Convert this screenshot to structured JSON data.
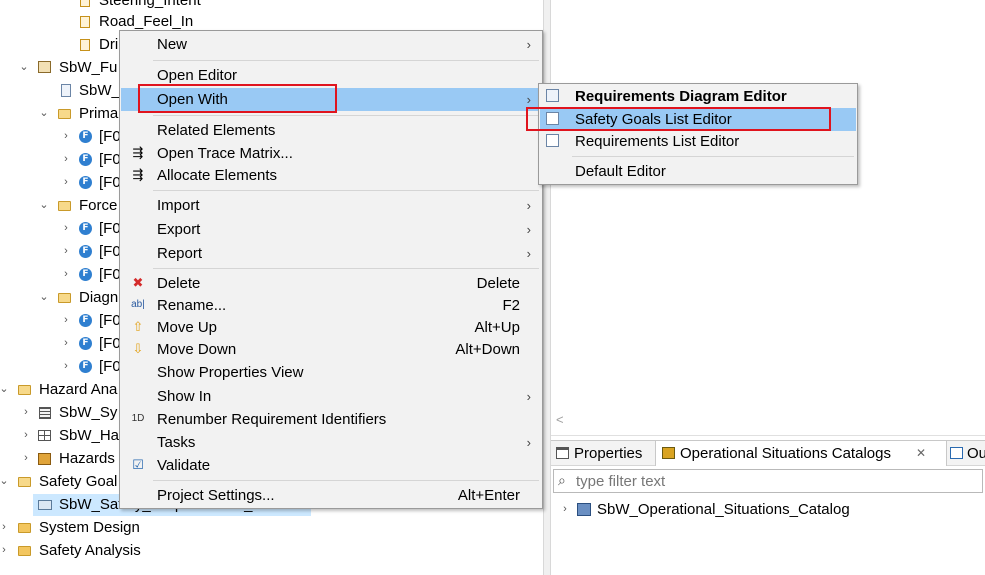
{
  "tree": {
    "items": [
      {
        "label": "Steering_Intent"
      },
      {
        "label": "Road_Feel_In"
      },
      {
        "label": "Dri"
      },
      {
        "label": "SbW_Fu"
      },
      {
        "label": "SbW_"
      },
      {
        "label": "Prima"
      },
      {
        "label": "[F0"
      },
      {
        "label": "[F0"
      },
      {
        "label": "[F0"
      },
      {
        "label": "Force"
      },
      {
        "label": "[F0"
      },
      {
        "label": "[F0"
      },
      {
        "label": "[F0"
      },
      {
        "label": "Diagn"
      },
      {
        "label": "[F0"
      },
      {
        "label": "[F0"
      },
      {
        "label": "[F0"
      },
      {
        "label": "Hazard Ana"
      },
      {
        "label": "SbW_Sy"
      },
      {
        "label": "SbW_Ha"
      },
      {
        "label": "Hazards"
      },
      {
        "label": "Safety Goal"
      },
      {
        "label": "SbW_Safety_Requirements_Model"
      },
      {
        "label": "System Design"
      },
      {
        "label": "Safety Analysis"
      }
    ]
  },
  "context_menu": {
    "items": [
      {
        "label": "New",
        "arrow": "›"
      },
      {
        "label": "Open Editor"
      },
      {
        "label": "Open With",
        "arrow": "›"
      },
      {
        "label": "Related Elements"
      },
      {
        "label": "Open Trace Matrix..."
      },
      {
        "label": "Allocate Elements"
      },
      {
        "label": "Import",
        "arrow": "›"
      },
      {
        "label": "Export",
        "arrow": "›"
      },
      {
        "label": "Report",
        "arrow": "›"
      },
      {
        "label": "Delete",
        "shortcut": "Delete"
      },
      {
        "label": "Rename...",
        "shortcut": "F2"
      },
      {
        "label": "Move Up",
        "shortcut": "Alt+Up"
      },
      {
        "label": "Move Down",
        "shortcut": "Alt+Down"
      },
      {
        "label": "Show Properties View"
      },
      {
        "label": "Show In",
        "arrow": "›"
      },
      {
        "label": "Renumber Requirement Identifiers"
      },
      {
        "label": "Tasks",
        "arrow": "›"
      },
      {
        "label": "Validate"
      },
      {
        "label": "Project Settings...",
        "shortcut": "Alt+Enter"
      }
    ],
    "icon_names": {
      "open_trace_matrix": "trace-matrix-icon",
      "allocate": "allocate-icon",
      "delete": "delete-x-icon",
      "rename": "rename-icon",
      "move_up": "arrow-up-icon",
      "move_down": "arrow-down-icon",
      "renumber": "renumber-icon",
      "validate": "validate-check-icon"
    }
  },
  "open_with_submenu": {
    "items": [
      {
        "label": "Requirements Diagram Editor"
      },
      {
        "label": "Safety Goals List Editor"
      },
      {
        "label": "Requirements List Editor"
      },
      {
        "label": "Default Editor"
      }
    ]
  },
  "bottom_panel": {
    "tabs": [
      {
        "label": "Properties"
      },
      {
        "label": "Operational Situations Catalogs",
        "close": "✕"
      },
      {
        "label": "Ou"
      }
    ],
    "filter_placeholder": "type filter text",
    "tree_items": [
      {
        "label": "SbW_Operational_Situations_Catalog"
      }
    ]
  },
  "colors": {
    "highlight": "#99c9f4",
    "annotation_red": "#e0141e",
    "selection": "#cce8ff"
  }
}
